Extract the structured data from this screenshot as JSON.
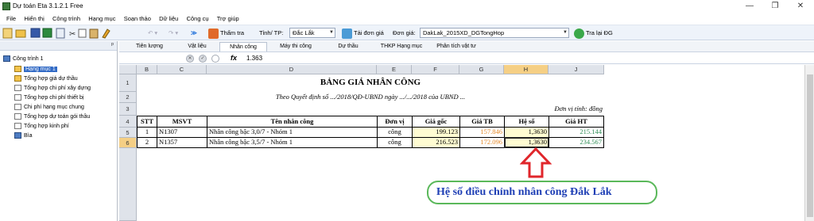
{
  "window": {
    "title": "Dự toán Eta 3.1.2.1 Free",
    "minimize": "—",
    "restore": "❐",
    "close": "✕"
  },
  "menu": [
    "File",
    "Hiển thị",
    "Công trình",
    "Hạng mục",
    "Soạn thảo",
    "Dữ liệu",
    "Công cụ",
    "Trợ giúp"
  ],
  "toolbar": {
    "check_label": "Thẩm tra",
    "province_label": "Tỉnh/ TP:",
    "province_value": "Đắc Lắk",
    "load_price_label": "Tải đơn giá",
    "price_label": "Đơn giá:",
    "price_value": "DakLak_2015XD_DGTongHop",
    "lookup_label": "Tra lại ĐG"
  },
  "tree": {
    "pin": "ᵖ",
    "items": [
      "Công trình 1",
      "Hạng mục 1",
      "Tổng hợp giá dự thầu",
      "Tổng hợp chi phí xây dựng",
      "Tổng hợp chi phí thiết bị",
      "Chi phí hạng mục chung",
      "Tổng hợp dự toán gói thầu",
      "Tổng hợp kinh phí",
      "Bìa"
    ]
  },
  "tabs": [
    "Tiên lượng",
    "Vật liệu",
    "Nhân công",
    "Máy thi công",
    "Dự thầu",
    "THKP Hạng mục",
    "Phân tích vật tư"
  ],
  "formula": {
    "value": "1.363",
    "fx": "fx",
    "cancel": "✕",
    "accept": "✓"
  },
  "columns": [
    "B",
    "C",
    "D",
    "E",
    "F",
    "G",
    "H",
    "J"
  ],
  "rows": [
    "1",
    "2",
    "3",
    "4",
    "5",
    "6"
  ],
  "sheet": {
    "title": "BẢNG GIÁ NHÂN CÔNG",
    "subtitle": "Theo Quyết định số .../2018/QĐ-UBND ngày .../.../2018 của UBND ...",
    "unit_note": "Đơn vị tính: đồng",
    "headers": [
      "STT",
      "MSVT",
      "Tên nhân công",
      "Đơn vị",
      "Giá gốc",
      "Giá TB",
      "Hệ số",
      "Giá HT"
    ],
    "data": [
      [
        "1",
        "N1307",
        "Nhân công bậc 3,0/7 - Nhóm 1",
        "công",
        "199.123",
        "157.846",
        "1,3630",
        "215.144"
      ],
      [
        "2",
        "N1357",
        "Nhân công bậc 3,5/7 - Nhóm 1",
        "công",
        "216.523",
        "172.096",
        "1,3630",
        "234.567"
      ]
    ]
  },
  "annotation": {
    "text": "Hệ số điều chỉnh nhân công Đắk Lắk"
  },
  "colors": {
    "accent_red": "#e0262b",
    "annot_border": "#5ab85a",
    "annot_text": "#1f3fb5",
    "selected": "#316ac5",
    "active_header": "#f5cf85"
  }
}
